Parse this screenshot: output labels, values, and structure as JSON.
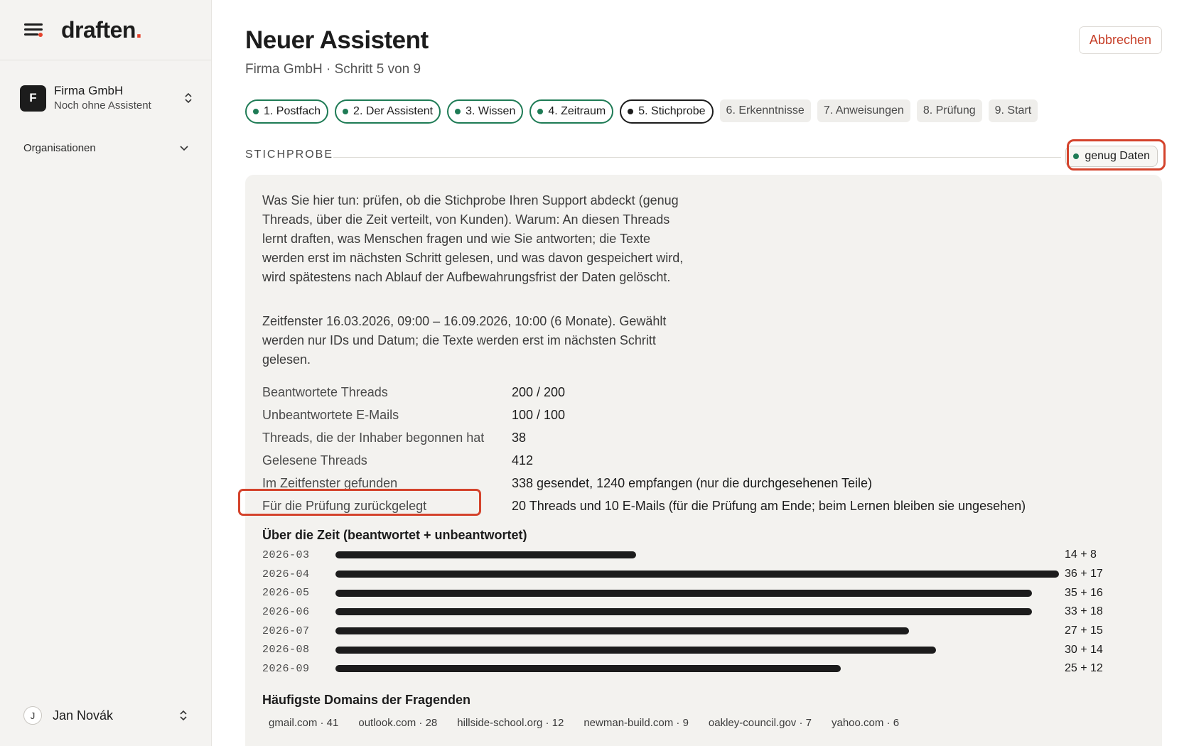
{
  "sidebar": {
    "logo": "draften",
    "logo_dot": ".",
    "org": {
      "avatar": "F",
      "name": "Firma GmbH",
      "subtitle": "Noch ohne Assistent"
    },
    "organizations_label": "Organisationen",
    "user": {
      "avatar": "J",
      "name": "Jan Novák"
    }
  },
  "header": {
    "title": "Neuer Assistent",
    "subtitle": "Firma GmbH · Schritt 5 von 9",
    "cancel_label": "Abbrechen"
  },
  "steps": [
    {
      "label": "1. Postfach",
      "state": "done"
    },
    {
      "label": "2. Der Assistent",
      "state": "done"
    },
    {
      "label": "3. Wissen",
      "state": "done"
    },
    {
      "label": "4. Zeitraum",
      "state": "done"
    },
    {
      "label": "5. Stichprobe",
      "state": "current"
    },
    {
      "label": "6. Erkenntnisse",
      "state": "todo"
    },
    {
      "label": "7. Anweisungen",
      "state": "todo"
    },
    {
      "label": "8. Prüfung",
      "state": "todo"
    },
    {
      "label": "9. Start",
      "state": "todo"
    }
  ],
  "section": {
    "label": "STICHPROBE",
    "status_badge": "genug Daten"
  },
  "panel": {
    "intro": "Was Sie hier tun: prüfen, ob die Stichprobe Ihren Support abdeckt (genug Threads, über die Zeit verteilt, von Kunden). Warum: An diesen Threads lernt draften, was Menschen fragen und wie Sie antworten; die Texte werden erst im nächsten Schritt gelesen, und was davon gespeichert wird, wird spätestens nach Ablauf der Aufbewahrungsfrist der Daten gelöscht.",
    "window_info": "Zeitfenster 16.03.2026, 09:00 – 16.09.2026, 10:00 (6 Monate). Gewählt werden nur IDs und Datum; die Texte werden erst im nächsten Schritt gelesen.",
    "stats": [
      {
        "label": "Beantwortete Threads",
        "value": "200 / 200"
      },
      {
        "label": "Unbeantwortete E-Mails",
        "value": "100 / 100"
      },
      {
        "label": "Threads, die der Inhaber begonnen hat",
        "value": "38"
      },
      {
        "label": "Gelesene Threads",
        "value": "412"
      },
      {
        "label": "Im Zeitfenster gefunden",
        "value": "338 gesendet, 1240 empfangen (nur die durchgesehenen Teile)"
      },
      {
        "label": "Für die Prüfung zurückgelegt",
        "value": "20 Threads und 10 E-Mails (für die Prüfung am Ende; beim Lernen bleiben sie ungesehen)"
      }
    ],
    "chart_title": "Über die Zeit (beantwortet + unbeantwortet)",
    "domains_title": "Häufigste Domains der Fragenden",
    "domains": [
      "gmail.com · 41",
      "outlook.com · 28",
      "hillside-school.org · 12",
      "newman-build.com · 9",
      "oakley-council.gov · 7",
      "yahoo.com · 6"
    ]
  },
  "chart_data": {
    "type": "bar",
    "orientation": "horizontal",
    "title": "Über die Zeit (beantwortet + unbeantwortet)",
    "categories": [
      "2026-03",
      "2026-04",
      "2026-05",
      "2026-06",
      "2026-07",
      "2026-08",
      "2026-09"
    ],
    "series": [
      {
        "values": [
          14,
          36,
          35,
          33,
          27,
          30,
          25
        ]
      },
      {
        "values": [
          8,
          17,
          16,
          18,
          15,
          14,
          12
        ]
      }
    ],
    "value_labels": [
      "14 + 8",
      "36 + 17",
      "35 + 16",
      "33 + 18",
      "27 + 15",
      "30 + 14",
      "25 + 12"
    ]
  }
}
